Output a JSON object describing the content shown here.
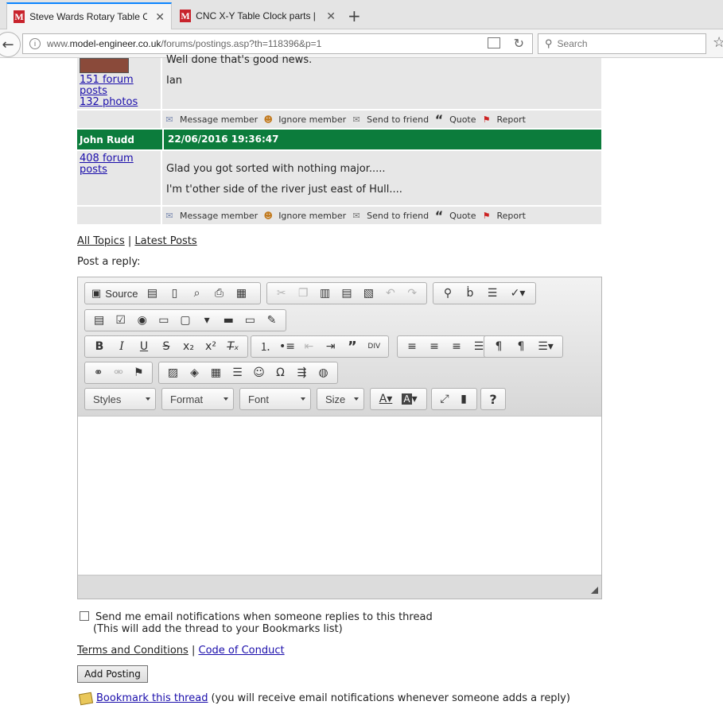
{
  "browser": {
    "tabs": [
      {
        "title": "Steve Wards Rotary Table Co...",
        "active": true
      },
      {
        "title": "CNC X-Y Table Clock parts | M...",
        "active": false
      }
    ],
    "url_prefix": "www.",
    "url_domain": "model-engineer.co.uk",
    "url_path": "/forums/postings.asp?th=118396&p=1",
    "search_placeholder": "Search",
    "favicon_letter": "M"
  },
  "posts": [
    {
      "partial_text": "Well done that's good news.",
      "signature": "Ian",
      "stats": [
        "151 forum",
        "posts",
        "132 photos"
      ]
    },
    {
      "author": "John Rudd",
      "date": "22/06/2016 19:36:47",
      "stats": [
        "408 forum",
        "posts"
      ],
      "lines": [
        "Glad you got sorted with nothing major.....",
        "I'm t'other side of the river just east of Hull...."
      ]
    }
  ],
  "actions": {
    "message": "Message member",
    "ignore": "Ignore member",
    "send": "Send to friend",
    "quote": "Quote",
    "report": "Report"
  },
  "nav": {
    "all_topics": "All Topics",
    "sep": "|",
    "latest_posts": "Latest Posts",
    "post_reply": "Post a reply:"
  },
  "editor": {
    "source_label": "Source",
    "styles": "Styles",
    "format": "Format",
    "font": "Font",
    "size": "Size"
  },
  "form": {
    "notify_line1": "Send me email notifications when someone replies to this thread",
    "notify_line2": "(This will add the thread to your Bookmarks list)",
    "terms": "Terms and Conditions",
    "conduct": "Code of Conduct",
    "sep": "|",
    "add_button": "Add Posting",
    "bookmark_link": "Bookmark this thread",
    "bookmark_note": "(you will receive email notifications whenever someone adds a reply)"
  },
  "colors": {
    "header_green": "#0c7c3c",
    "link_blue": "#1a0dab",
    "tab_accent": "#0a84ff"
  }
}
